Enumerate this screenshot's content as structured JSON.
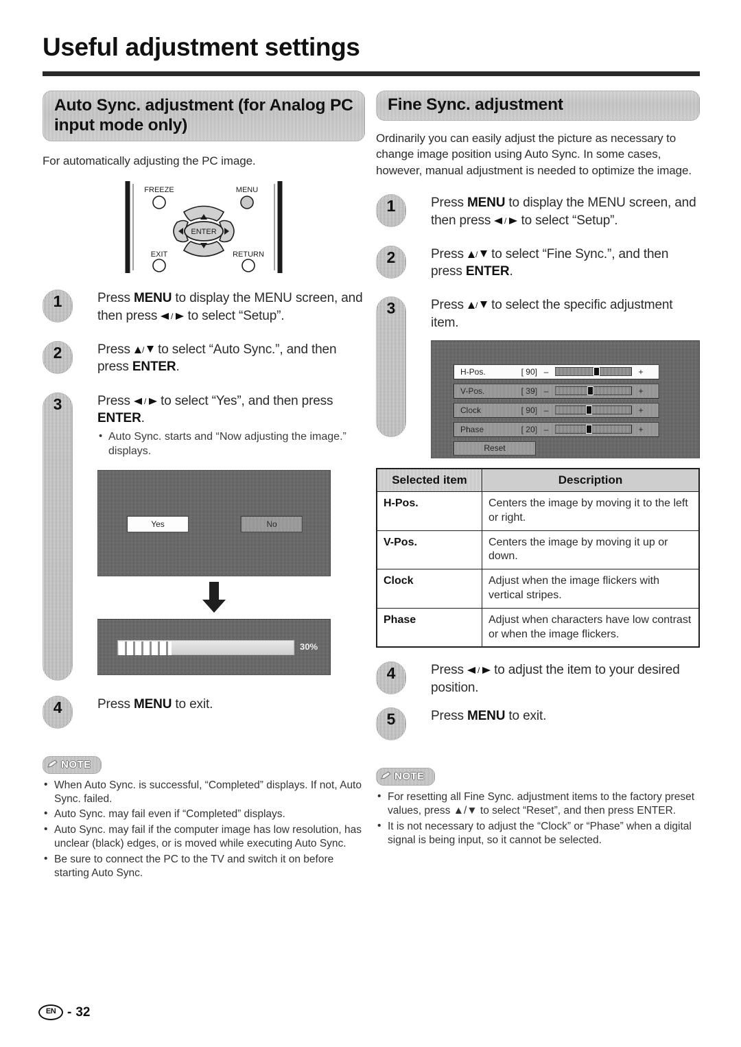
{
  "page": {
    "title": "Useful adjustment settings",
    "footer": {
      "lang_code": "EN",
      "separator": "-",
      "page_number": "32"
    }
  },
  "left_column": {
    "section_title": "Auto Sync. adjustment (for Analog PC input mode only)",
    "intro": "For automatically adjusting the PC image.",
    "remote_figure": {
      "labels": {
        "freeze": "FREEZE",
        "menu": "MENU",
        "exit": "EXIT",
        "return": "RETURN",
        "enter": "ENTER"
      }
    },
    "steps": [
      {
        "number": "1",
        "text_parts": [
          {
            "t": "Press ",
            "b": false
          },
          {
            "t": "MENU",
            "b": true
          },
          {
            "t": " to display the MENU screen, and then press ",
            "b": false
          },
          {
            "t": "◀/▶",
            "b": false,
            "glyph": "lr"
          },
          {
            "t": " to select “Setup”.",
            "b": false
          }
        ],
        "plain": "Press MENU to display the MENU screen, and then press ◀/▶ to select “Setup”."
      },
      {
        "number": "2",
        "plain": "Press ▲/▼ to select “Auto Sync.”, and then press ENTER."
      },
      {
        "number": "3",
        "plain": "Press ◀/▶ to select “Yes”, and then press ENTER.",
        "bullet": "Auto Sync. starts and “Now adjusting the image.” displays."
      },
      {
        "number": "4",
        "plain": "Press MENU to exit."
      }
    ],
    "dialog_osd": {
      "yes_label": "Yes",
      "no_label": "No",
      "selected": "Yes"
    },
    "progress_osd": {
      "percent_label": "30%",
      "percent_value": 30
    },
    "note": {
      "badge": "NOTE",
      "items": [
        "When Auto Sync. is successful, “Completed” displays. If not, Auto Sync. failed.",
        "Auto Sync. may fail even if “Completed” displays.",
        "Auto Sync. may fail if the computer image has low resolution, has unclear (black) edges, or is moved while executing Auto Sync.",
        "Be sure to connect the PC to the TV and switch it on before starting Auto Sync."
      ]
    }
  },
  "right_column": {
    "section_title": "Fine Sync. adjustment",
    "intro": "Ordinarily you can easily adjust the picture as necessary to change image position using Auto Sync. In some cases, however, manual adjustment is needed to optimize the image.",
    "steps": [
      {
        "number": "1",
        "plain": "Press MENU to display the MENU screen, and then press ◀/▶ to select “Setup”."
      },
      {
        "number": "2",
        "plain": "Press ▲/▼ to select “Fine Sync.”, and then press ENTER."
      },
      {
        "number": "3",
        "plain": "Press ▲/▼ to select the specific adjustment item."
      },
      {
        "number": "4",
        "plain": "Press ◀/▶ to adjust the item to your desired position."
      },
      {
        "number": "5",
        "plain": "Press MENU to exit."
      }
    ],
    "fine_sync_osd": {
      "rows": [
        {
          "name": "H-Pos.",
          "value": "[ 90]",
          "minus": "–",
          "plus": "+",
          "knob_pct": 50,
          "selected": true
        },
        {
          "name": "V-Pos.",
          "value": "[ 39]",
          "minus": "–",
          "plus": "+",
          "knob_pct": 42,
          "selected": false
        },
        {
          "name": "Clock",
          "value": "[ 90]",
          "minus": "–",
          "plus": "+",
          "knob_pct": 40,
          "selected": false
        },
        {
          "name": "Phase",
          "value": "[ 20]",
          "minus": "–",
          "plus": "+",
          "knob_pct": 40,
          "selected": false
        }
      ],
      "reset_label": "Reset"
    },
    "table": {
      "headers": [
        "Selected item",
        "Description"
      ],
      "rows": [
        {
          "item": "H-Pos.",
          "desc": "Centers the image by moving it to the left or right."
        },
        {
          "item": "V-Pos.",
          "desc": "Centers the image by moving it up or down."
        },
        {
          "item": "Clock",
          "desc": "Adjust when the image flickers with vertical stripes."
        },
        {
          "item": "Phase",
          "desc": "Adjust when characters have low contrast or when the image flickers."
        }
      ]
    },
    "note": {
      "badge": "NOTE",
      "items": [
        "For resetting all Fine Sync. adjustment items to the factory preset values, press ▲/▼ to select “Reset”, and then press ENTER.",
        "It is not necessary to adjust the “Clock” or “Phase” when a digital signal is being input, so it cannot be selected."
      ]
    }
  }
}
